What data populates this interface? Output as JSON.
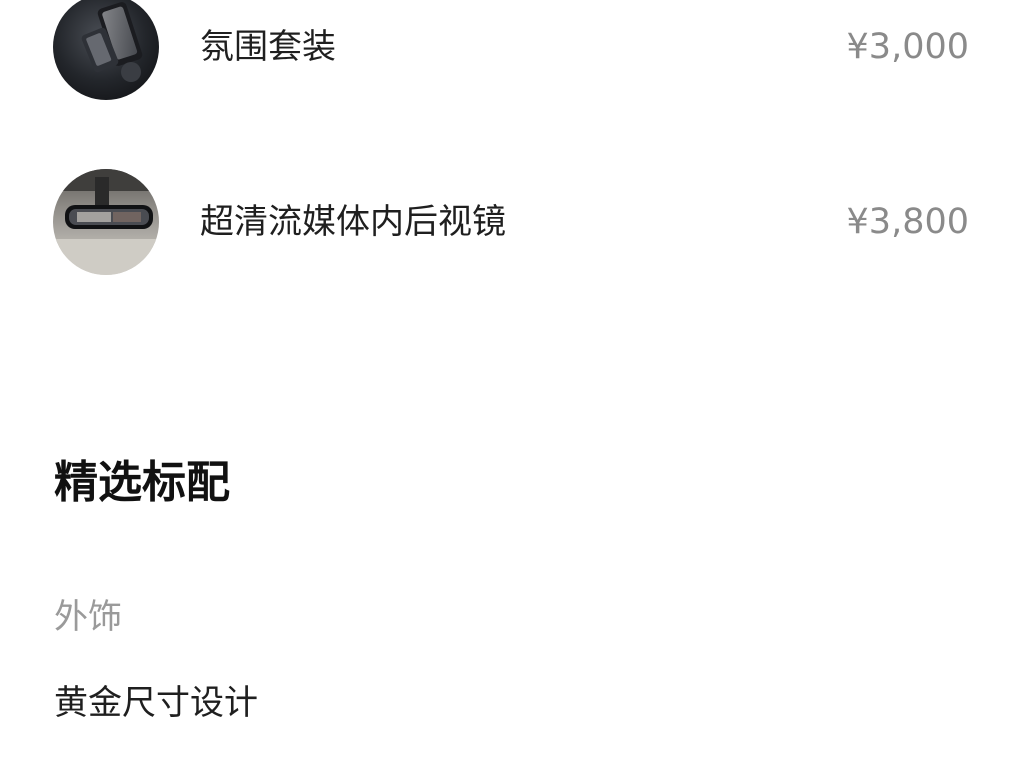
{
  "options": [
    {
      "name": "氛围套装",
      "price": "¥3,000",
      "thumbnail_icon": "ambient-light-kit-photo"
    },
    {
      "name": "超清流媒体内后视镜",
      "price": "¥3,800",
      "thumbnail_icon": "streaming-rearview-mirror-photo"
    }
  ],
  "standard_features": {
    "title": "精选标配",
    "categories": [
      {
        "label": "外饰",
        "items": [
          "黄金尺寸设计"
        ]
      }
    ]
  },
  "colors": {
    "primary_text": "#1f1f1f",
    "secondary_text": "#8a8a8a",
    "background": "#ffffff"
  }
}
